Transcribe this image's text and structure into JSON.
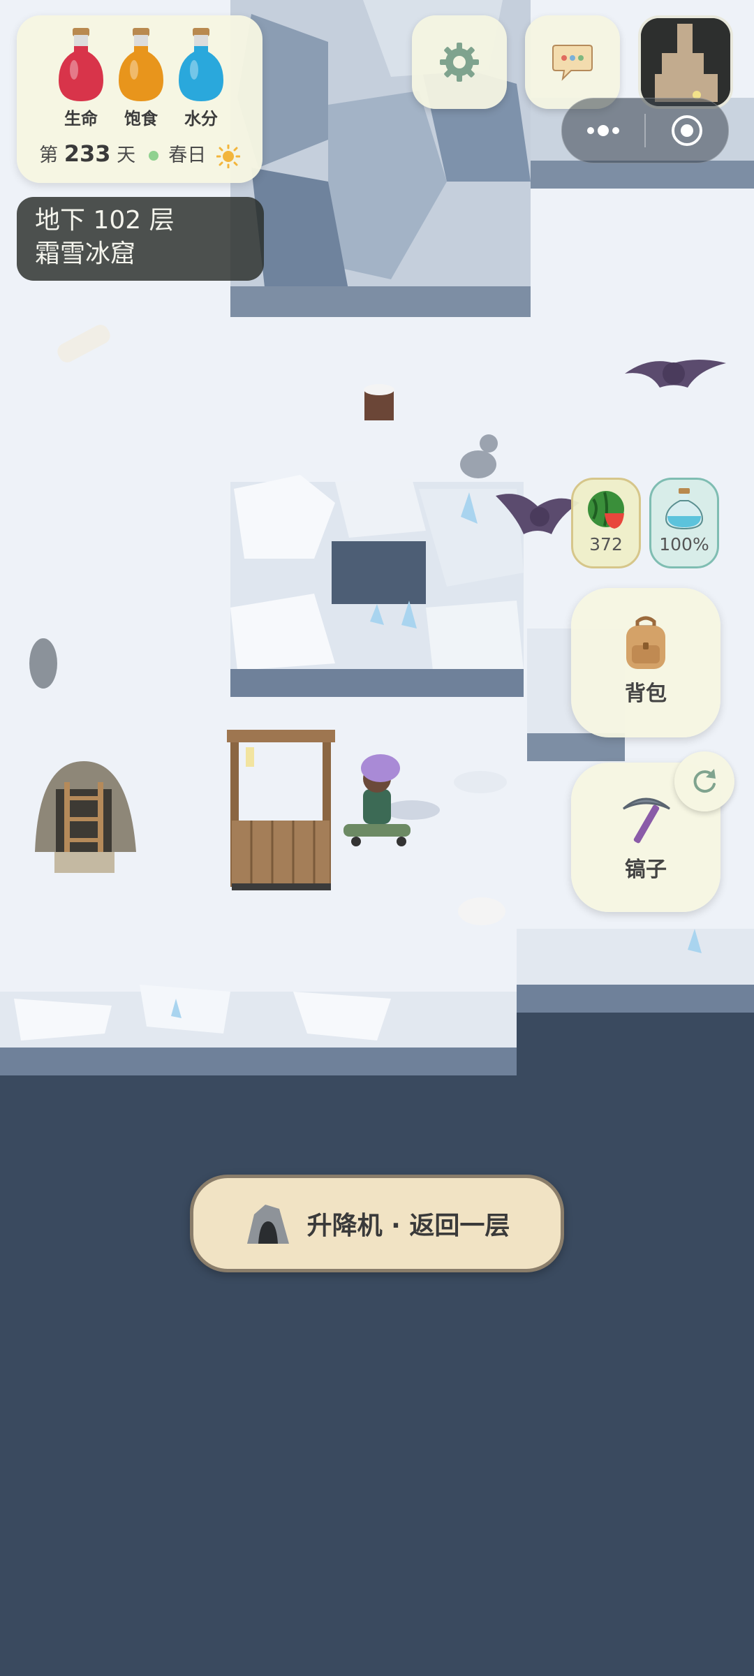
{
  "stats": {
    "health_label": "生命",
    "hunger_label": "饱食",
    "water_label": "水分",
    "colors": {
      "health": "#d8344a",
      "hunger": "#e8951c",
      "water": "#2aa8dc"
    }
  },
  "calendar": {
    "day_prefix": "第",
    "day_number": "233",
    "day_suffix": "天",
    "season": "春日",
    "weather_icon": "sun-icon"
  },
  "location": {
    "floor": "地下 102 层",
    "area": "霜雪冰窟"
  },
  "top_buttons": {
    "settings_icon": "gear-icon",
    "chat_icon": "chat-bubble-icon",
    "minimap_icon": "minimap"
  },
  "items": {
    "watermelon_count": "372",
    "water_bottle_level": "100%"
  },
  "actions": {
    "backpack_label": "背包",
    "pickaxe_label": "镐子"
  },
  "elevator": {
    "label": "升降机 · 返回一层",
    "icon": "cave-icon"
  }
}
